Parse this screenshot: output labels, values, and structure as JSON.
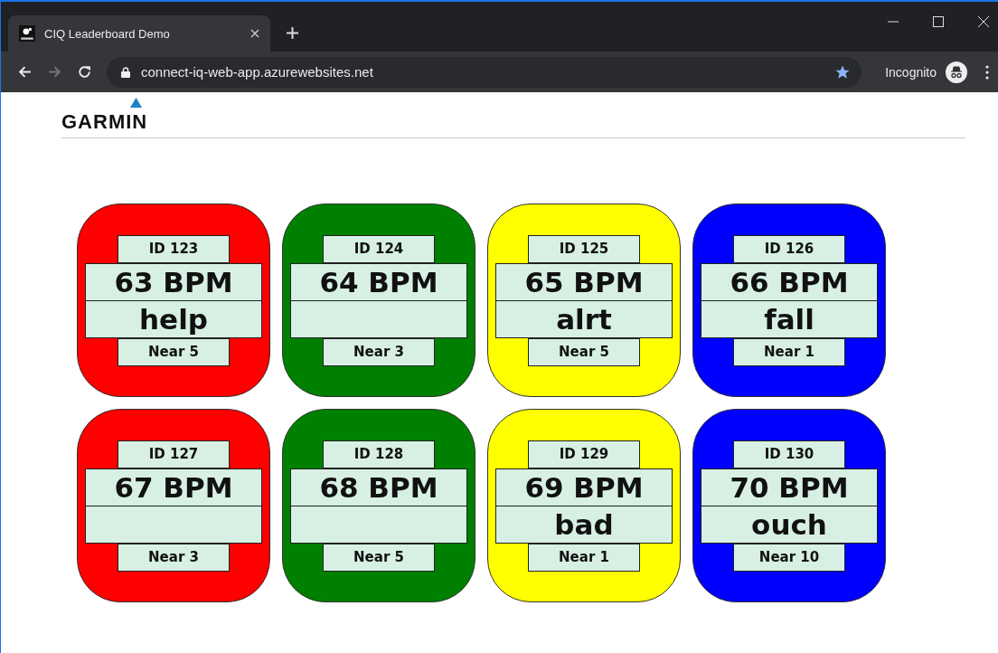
{
  "browser": {
    "tab_title": "CIQ Leaderboard Demo",
    "url": "connect-iq-web-app.azurewebsites.net",
    "profile": "Incognito"
  },
  "logo": {
    "text": "GARMIN"
  },
  "cards": [
    {
      "id": "ID 123",
      "bpm": "63 BPM",
      "status": "help",
      "near": "Near 5",
      "color": "#ff0000"
    },
    {
      "id": "ID 124",
      "bpm": "64 BPM",
      "near": "Near 3",
      "color": "#008000"
    },
    {
      "id": "ID 125",
      "bpm": "65 BPM",
      "status": "alrt",
      "near": "Near 5",
      "color": "#ffff00"
    },
    {
      "id": "ID 126",
      "bpm": "66 BPM",
      "status": "fall",
      "near": "Near 1",
      "color": "#0000ff"
    },
    {
      "id": "ID 127",
      "bpm": "67 BPM",
      "near": "Near 3",
      "color": "#ff0000"
    },
    {
      "id": "ID 128",
      "bpm": "68 BPM",
      "near": "Near 5",
      "color": "#008000"
    },
    {
      "id": "ID 129",
      "bpm": "69 BPM",
      "status": "bad",
      "near": "Near 1",
      "color": "#ffff00"
    },
    {
      "id": "ID 130",
      "bpm": "70 BPM",
      "status": "ouch",
      "near": "Near 10",
      "color": "#0000ff"
    }
  ]
}
